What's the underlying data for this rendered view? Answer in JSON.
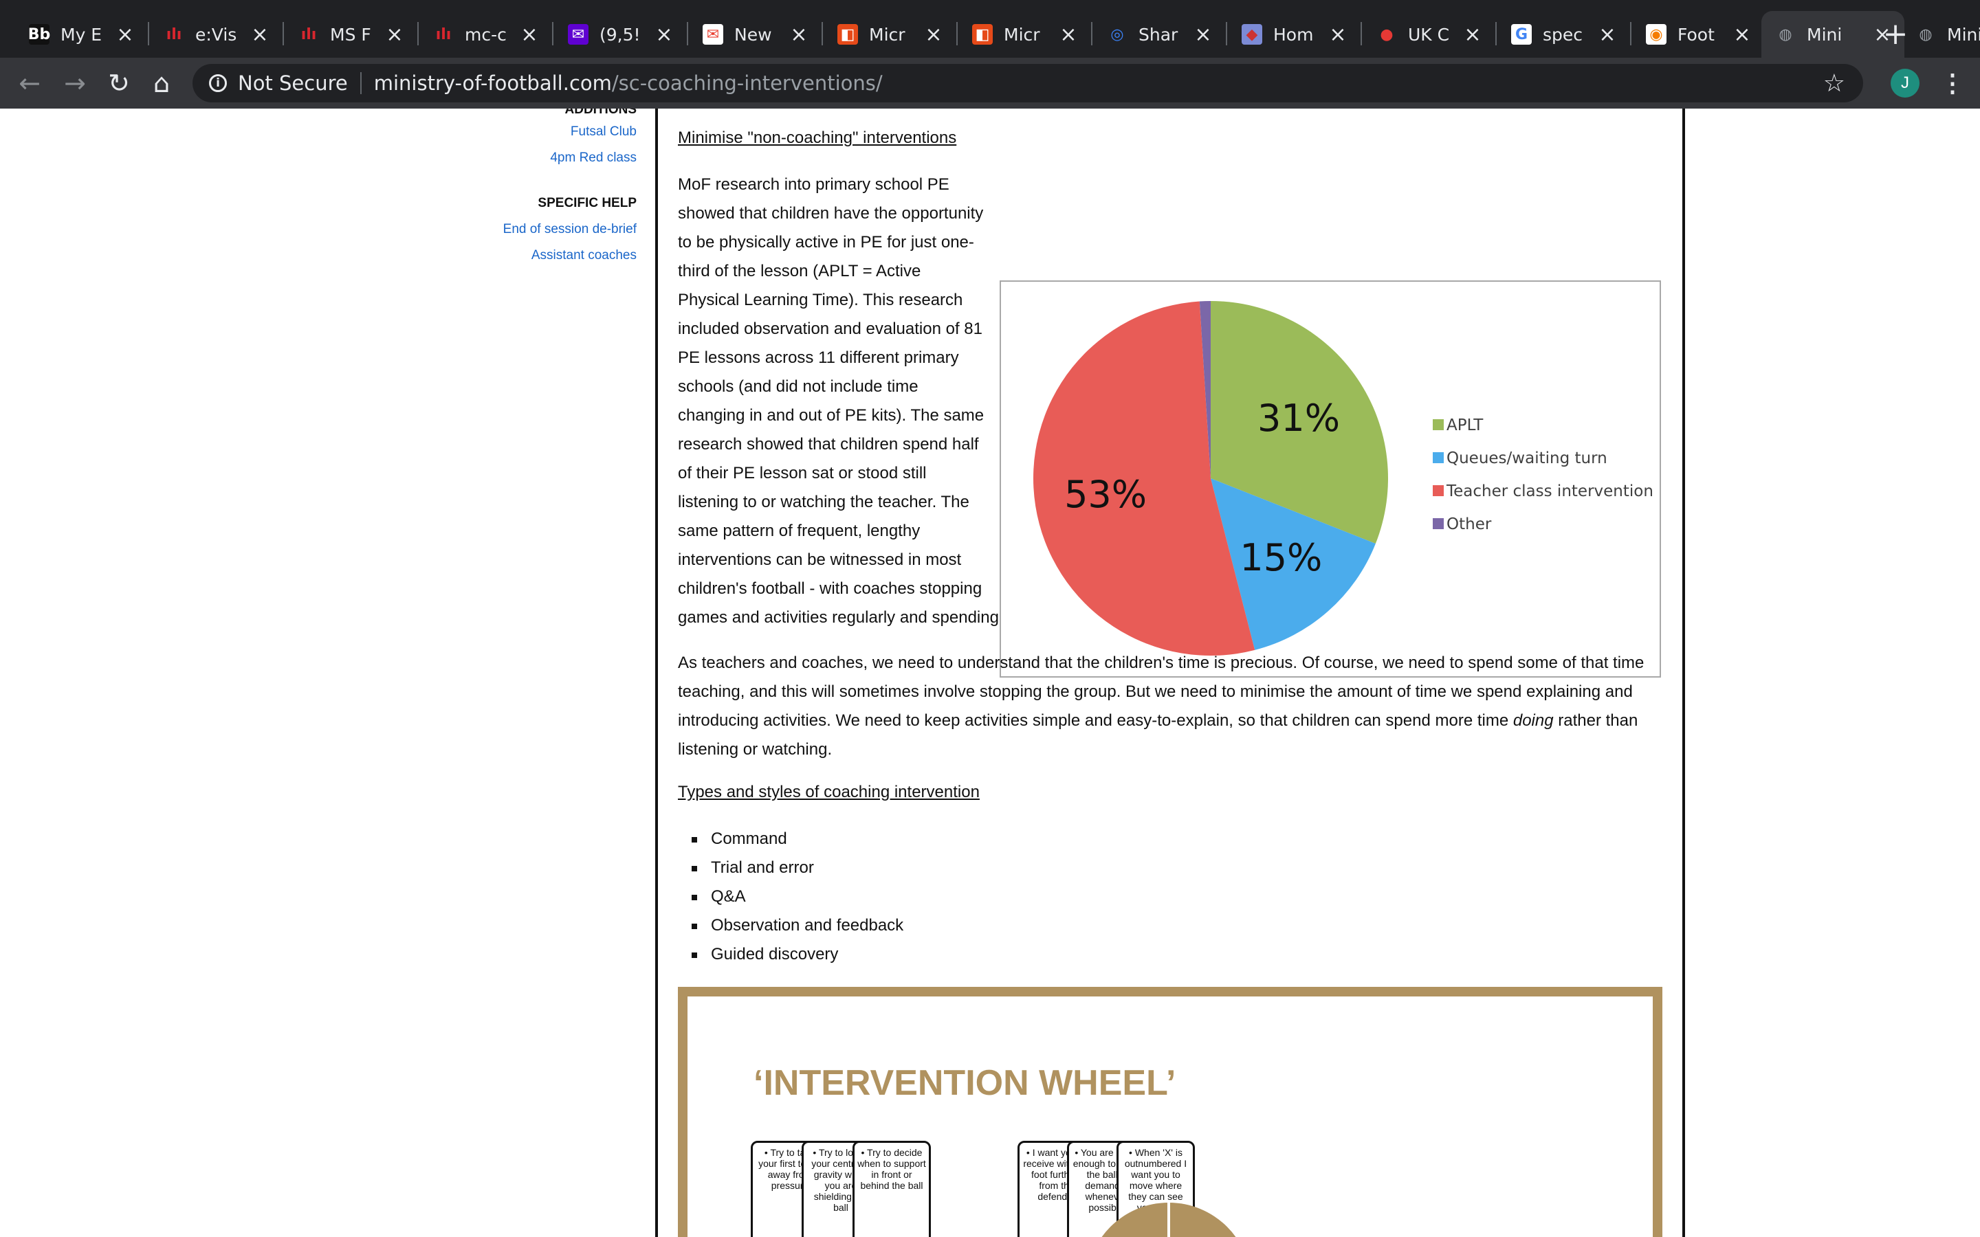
{
  "browser": {
    "tabs": [
      {
        "title": "My E",
        "icon": "blackboard-icon",
        "active": false
      },
      {
        "title": "e:Vis",
        "icon": "evision-icon",
        "active": false
      },
      {
        "title": "MS F",
        "icon": "evision-icon",
        "active": false
      },
      {
        "title": "mc-c",
        "icon": "evision-icon",
        "active": false
      },
      {
        "title": "(9,5!",
        "icon": "yahoo-mail-icon",
        "active": false
      },
      {
        "title": "New",
        "icon": "gmail-icon",
        "active": false
      },
      {
        "title": "Micr",
        "icon": "office-icon",
        "active": false
      },
      {
        "title": "Micr",
        "icon": "office-icon",
        "active": false
      },
      {
        "title": "Shar",
        "icon": "sharing-icon",
        "active": false
      },
      {
        "title": "Hom",
        "icon": "home-site-icon",
        "active": false
      },
      {
        "title": "UK C",
        "icon": "uk-site-icon",
        "active": false
      },
      {
        "title": "spec",
        "icon": "google-icon",
        "active": false
      },
      {
        "title": "Foot",
        "icon": "lifebuoy-icon",
        "active": false
      },
      {
        "title": "Mini",
        "icon": "globe-icon",
        "active": true
      },
      {
        "title": "Mini",
        "icon": "globe-icon",
        "active": false
      }
    ],
    "security_label": "Not Secure",
    "url_host": "ministry-of-football.com",
    "url_path": "/sc-coaching-interventions/",
    "profile_initial": "J"
  },
  "sidebar": {
    "additions_heading": "ADDITIONS",
    "additions_links": [
      "Futsal Club",
      "4pm Red class"
    ],
    "specific_help_heading": "SPECIFIC HELP",
    "specific_help_links": [
      "End of session de-brief",
      "Assistant coaches"
    ]
  },
  "article": {
    "section1_heading": "Minimise \"non-coaching\" interventions",
    "para1_lines": [
      "MoF research into primary school PE",
      "showed that children have the opportunity",
      "to be physically active in PE for just one-",
      "third of the lesson (APLT = Active",
      "Physical Learning Time). This research",
      "included observation and evaluation of 81",
      "PE lessons across 11 different primary",
      "schools (and did not include time",
      "changing in and out of PE kits). The same",
      "research showed that children spend half",
      "of their PE lesson sat or stood still",
      "listening to or watching the teacher. The",
      "same pattern of frequent, lengthy",
      "interventions can be witnessed in most",
      "children's football - with coaches stopping"
    ],
    "para1_last": "games and activities regularly and spending far too long to introduce, explain and organise the next activity.",
    "para2_a": "As teachers and coaches, we need to understand that the children's time is precious. Of course, we need to spend some of that time teaching, and this will sometimes involve stopping the group. But we need to minimise the amount of time we spend explaining and introducing activities. We need to keep activities simple and easy-to-explain, so that children can spend more time ",
    "para2_em": "doing",
    "para2_b": " rather than listening or watching.",
    "section2_heading": "Types and styles of coaching intervention",
    "intervention_types": [
      "Command",
      "Trial and error",
      "Q&A",
      "Observation and feedback",
      "Guided discovery"
    ]
  },
  "chart_data": {
    "type": "pie",
    "title": "",
    "slices": [
      {
        "label": "APLT",
        "value": 31,
        "display": "31%",
        "color": "#9bbb59"
      },
      {
        "label": "Queues/waiting turn",
        "value": 15,
        "display": "15%",
        "color": "#4bacec"
      },
      {
        "label": "Teacher class intervention",
        "value": 53,
        "display": "53%",
        "color": "#e85c57"
      },
      {
        "label": "Other",
        "value": 1,
        "display": "",
        "color": "#7b67a8"
      }
    ],
    "legend_position": "right"
  },
  "wheel": {
    "title": "‘INTERVENTION WHEEL’",
    "cards": [
      {
        "text": "• Try to take your first touch away from pressure",
        "color": "#e8332f"
      },
      {
        "text": "• Try to lower your centre of gravity when you are shielding the ball",
        "color": "#f2e52a"
      },
      {
        "text": "• Try to decide when to support in front or behind the ball",
        "color": "#3aa651"
      },
      {
        "text": "• I want you to receive with the foot furthest from the defender",
        "color": "#e8332f"
      },
      {
        "text": "• You are good enough to keep the ball – demand it whenever possible",
        "color": "#3aa651"
      },
      {
        "text": "• When 'X' is outnumbered I want you to move where they can see your feet",
        "color": "#2a63b8"
      }
    ]
  }
}
